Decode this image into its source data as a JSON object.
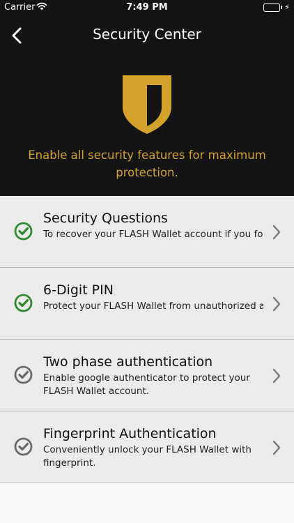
{
  "status_bar": {
    "carrier": "Carrier",
    "time": "7:49 PM",
    "wifi_icon": "wifi-icon",
    "battery_icon": "battery-icon",
    "battery_color": "#4cd964"
  },
  "navbar": {
    "title": "Security Center",
    "back_icon": "chevron-left-icon"
  },
  "hero": {
    "icon": "shield-icon",
    "icon_color": "#d4a12a",
    "tagline": "Enable all security features for maximum protection."
  },
  "security_items": [
    {
      "title": "Security Questions",
      "description": "To recover your FLASH Wallet account if you forget your password.",
      "status": "enabled",
      "status_color": "#2e8a2e"
    },
    {
      "title": "6-Digit PIN",
      "description": "Protect your FLASH Wallet from unauthorized access.",
      "status": "enabled",
      "status_color": "#2e8a2e"
    },
    {
      "title": "Two phase authentication",
      "description": "Enable google authenticator to protect your FLASH Wallet account.",
      "status": "disabled",
      "status_color": "#6a6a6a"
    },
    {
      "title": "Fingerprint Authentication",
      "description": "Conveniently unlock your FLASH Wallet with fingerprint.",
      "status": "disabled",
      "status_color": "#6a6a6a"
    }
  ]
}
